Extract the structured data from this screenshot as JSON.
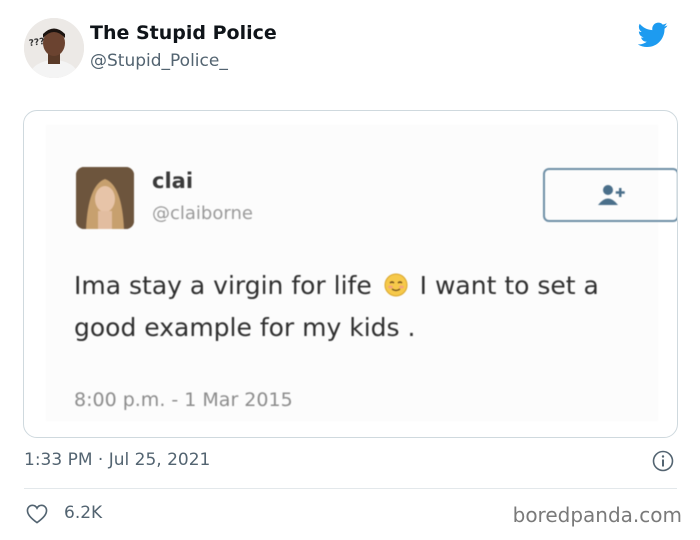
{
  "author": {
    "name": "The Stupid Police",
    "handle": "@Stupid_Police_",
    "avatar_icon": "person-photo-avatar",
    "avatar_text": "???"
  },
  "platform_icon": "twitter-bird-icon",
  "embedded_tweet": {
    "name": "clai",
    "handle": "@claiborne",
    "text_before_emoji": "Ima stay a virgin for life",
    "emoji": "smiling-face-with-smiling-eyes",
    "text_after_emoji": "I want to set a good example for my kids .",
    "timestamp": "8:00 p.m. - 1 Mar 2015",
    "follow_icon": "follow-user-icon"
  },
  "tweet_meta": {
    "timestamp": "1:33 PM · Jul 25, 2021",
    "info_icon": "info-icon"
  },
  "engagement": {
    "like_icon": "heart-icon",
    "likes": "6.2K"
  },
  "watermark": "boredpanda.com",
  "colors": {
    "twitter_blue": "#1d9bf0",
    "secondary_text": "#536471",
    "follow_border": "#6e8fa6"
  }
}
